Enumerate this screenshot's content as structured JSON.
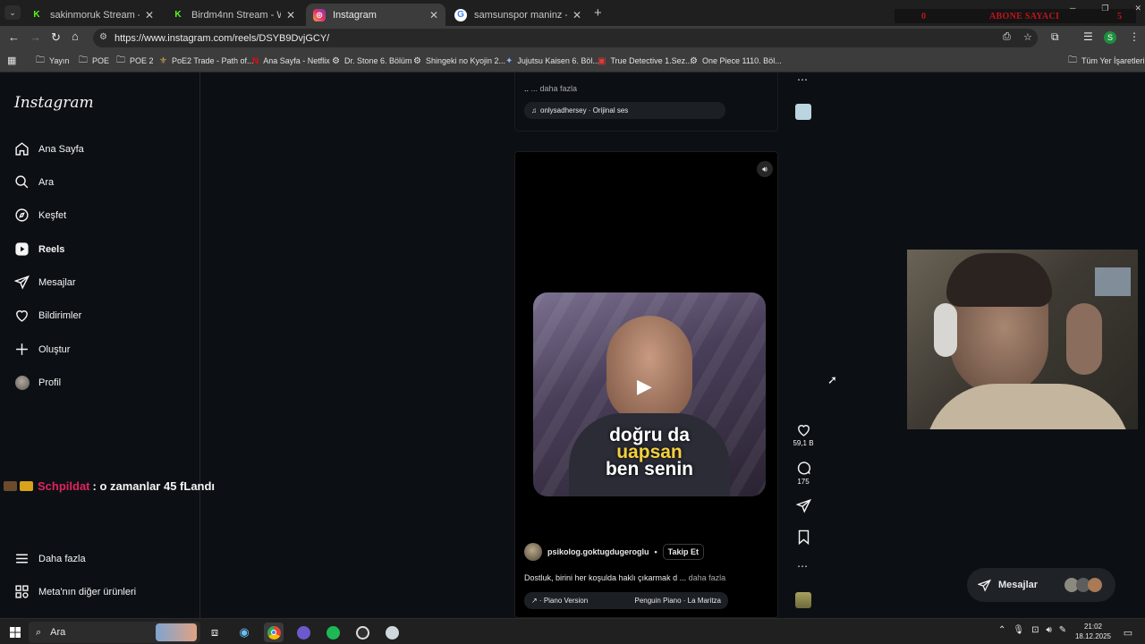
{
  "browser": {
    "tabs": [
      {
        "title": "sakinmoruk Stream - Watch Live",
        "icon": "kick-icon",
        "active": false
      },
      {
        "title": "Birdm4nn Stream - Watch Live",
        "icon": "kick-icon",
        "active": false
      },
      {
        "title": "Instagram",
        "icon": "instagram-icon",
        "active": true
      },
      {
        "title": "samsunspor maninz - Google'da",
        "icon": "google-icon",
        "active": false
      }
    ],
    "overlay": {
      "left_count": "0",
      "label": "ABONE SAYACI",
      "right_count": "5"
    },
    "url": "https://www.instagram.com/reels/DSYB9DvjGCY/",
    "profile_initial": "S",
    "bookmarks": [
      {
        "label": "Yayın",
        "icon": "folder-icon"
      },
      {
        "label": "POE",
        "icon": "folder-icon"
      },
      {
        "label": "POE 2",
        "icon": "folder-icon"
      },
      {
        "label": "PoE2 Trade - Path of...",
        "icon": "poe-icon"
      },
      {
        "label": "Ana Sayfa - Netflix",
        "icon": "netflix-icon"
      },
      {
        "label": "Dr. Stone 6. Bölüm",
        "icon": "gear-icon"
      },
      {
        "label": "Shingeki no Kyojin 2...",
        "icon": "gear-icon"
      },
      {
        "label": "Jujutsu Kaisen 6. Böl...",
        "icon": "anime-icon"
      },
      {
        "label": "True Detective 1.Sez...",
        "icon": "tv-icon"
      },
      {
        "label": "One Piece 1110. Böl...",
        "icon": "gear-icon"
      }
    ],
    "all_bookmarks": "Tüm Yer İşaretleri"
  },
  "instagram": {
    "logo": "Instagram",
    "nav": [
      {
        "label": "Ana Sayfa",
        "icon": "home-icon"
      },
      {
        "label": "Ara",
        "icon": "search-icon"
      },
      {
        "label": "Keşfet",
        "icon": "compass-icon"
      },
      {
        "label": "Reels",
        "icon": "reels-icon"
      },
      {
        "label": "Mesajlar",
        "icon": "messages-icon"
      },
      {
        "label": "Bildirimler",
        "icon": "heart-icon"
      },
      {
        "label": "Oluştur",
        "icon": "plus-icon"
      },
      {
        "label": "Profil",
        "icon": "avatar"
      }
    ],
    "more": "Daha fazla",
    "meta": "Meta'nın diğer ürünleri",
    "prev_post": {
      "caption": "..",
      "more": "... daha fazla",
      "audio": "onlysadhersey · Orijinal ses"
    },
    "post": {
      "subtitle_lines": [
        "doğru da",
        "uapsan",
        "ben senin"
      ],
      "username": "psikolog.goktugdugeroglu",
      "follow": "Takip Et",
      "caption": "Dostluk, birini her koşulda haklı çıkarmak d ...",
      "more": "daha fazla",
      "audio_left": "↗ · Piano Version",
      "audio_right": "Penguin Piano · La Maritza",
      "likes": "59,1 B",
      "comments": "175"
    },
    "messages_button": "Mesajlar"
  },
  "stream_overlay": {
    "chat_user": "Schpildat",
    "chat_text": ": o zamanlar 45 fLandı"
  },
  "taskbar": {
    "search": "Ara",
    "time": "21:02",
    "date": "18.12.2025"
  },
  "colors": {
    "accent": "#0095f6",
    "chat_user": "#e0245e",
    "overlay_text": "#c0141c"
  }
}
